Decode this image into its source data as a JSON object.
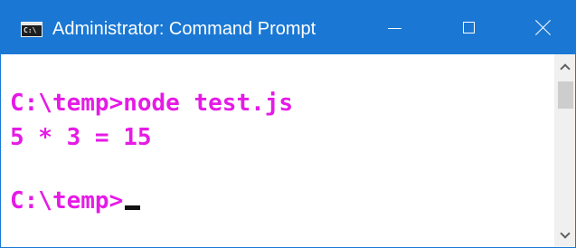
{
  "window": {
    "title": "Administrator: Command Prompt",
    "app_icon": "cmd-icon",
    "app_icon_glyph": "C:\\",
    "controls": {
      "minimize_icon": "minimize-icon",
      "maximize_icon": "maximize-icon",
      "close_icon": "close-icon"
    }
  },
  "console": {
    "lines": [
      "C:\\temp>node test.js",
      "5 * 3 = 15",
      "C:\\temp>"
    ],
    "text_color": "#e61ae6",
    "background_color": "#ffffff"
  },
  "scrollbar": {
    "up_icon": "chevron-up-icon",
    "down_icon": "chevron-down-icon"
  },
  "colors": {
    "titlebar": "#1a78d4",
    "title_text": "#ffffff"
  }
}
